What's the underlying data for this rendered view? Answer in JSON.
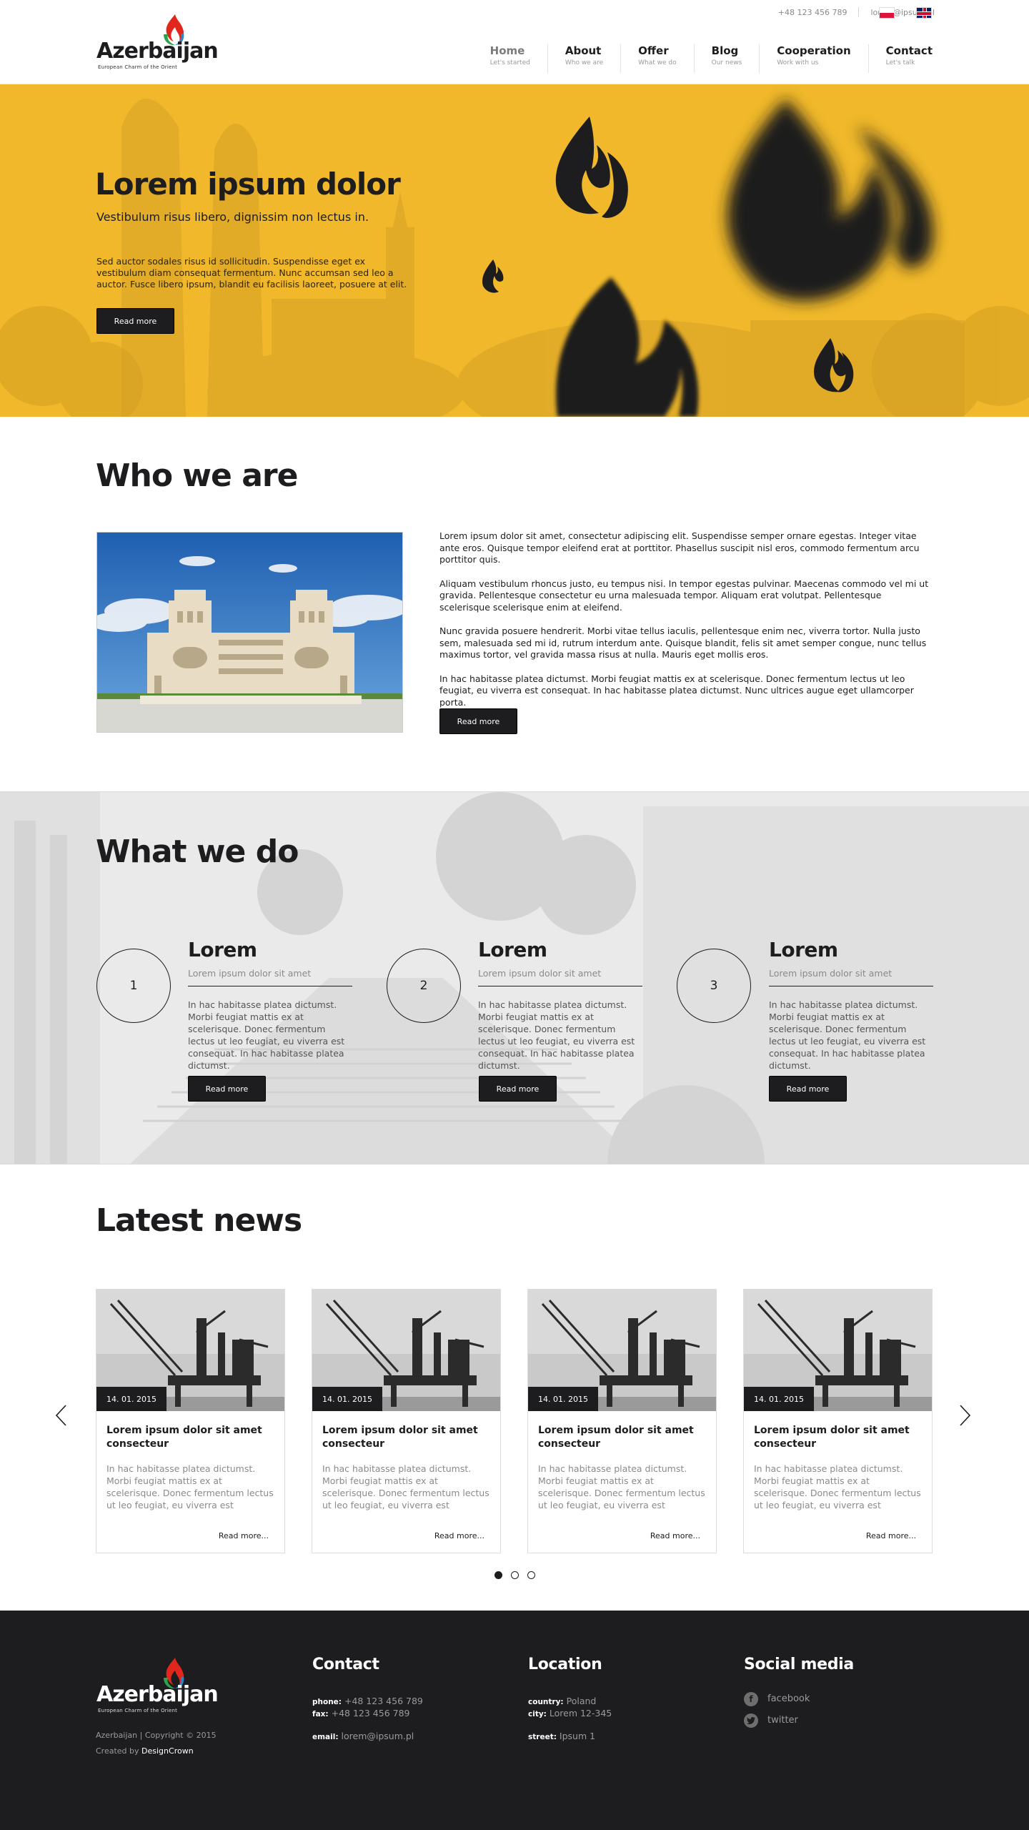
{
  "header": {
    "phone": "+48 123 456 789",
    "email": "lorem@ipsum.pl",
    "logo": {
      "name": "Azerbaijan",
      "tagline": "European Charm of the Orient"
    },
    "nav": [
      {
        "label": "Home",
        "sub": "Let's started"
      },
      {
        "label": "About",
        "sub": "Who we are"
      },
      {
        "label": "Offer",
        "sub": "What we do"
      },
      {
        "label": "Blog",
        "sub": "Our news"
      },
      {
        "label": "Cooperation",
        "sub": "Work with us"
      },
      {
        "label": "Contact",
        "sub": "Let's talk"
      }
    ],
    "languages": [
      "flag-pl-icon",
      "flag-uk-icon"
    ]
  },
  "hero": {
    "title": "Lorem ipsum dolor",
    "subtitle": "Vestibulum risus libero, dignissim non lectus in.",
    "body": "Sed auctor sodales risus id sollicitudin. Suspendisse eget ex vestibulum diam consequat fermentum. Nunc accumsan sed leo a auctor. Fusce libero ipsum, blandit eu facilisis laoreet, posuere at elit.",
    "button": "Read more",
    "color": "#f0b82a"
  },
  "who": {
    "title": "Who we are",
    "paragraphs": [
      "Lorem ipsum dolor sit amet, consectetur adipiscing elit. Suspendisse semper ornare egestas. Integer vitae ante eros. Quisque tempor eleifend erat at porttitor. Phasellus suscipit nisl eros, commodo fermentum arcu porttitor quis.",
      "Aliquam vestibulum rhoncus justo, eu tempus nisi. In tempor egestas pulvinar. Maecenas commodo vel mi ut gravida. Pellentesque consectetur eu urna malesuada tempor. Aliquam erat volutpat. Pellentesque scelerisque scelerisque enim at eleifend.",
      "Nunc gravida posuere hendrerit. Morbi vitae tellus iaculis, pellentesque enim nec, viverra tortor. Nulla justo sem, malesuada sed mi id, rutrum interdum ante. Quisque blandit, felis sit amet semper congue, nunc tellus maximus tortor, vel gravida massa risus at nulla. Mauris eget mollis eros.",
      "In hac habitasse platea dictumst. Morbi feugiat mattis ex at scelerisque. Donec fermentum lectus ut leo feugiat, eu viverra est consequat. In hac habitasse platea dictumst. Nunc ultrices augue eget ullamcorper porta."
    ],
    "button": "Read more"
  },
  "what": {
    "title": "What we do",
    "items": [
      {
        "number": "1",
        "title": "Lorem",
        "sub": "Lorem ipsum dolor sit amet",
        "body": "In hac habitasse platea dictumst. Morbi feugiat mattis ex at scelerisque. Donec fermentum lectus ut leo feugiat, eu viverra est consequat. In hac habitasse platea dictumst.",
        "button": "Read more"
      },
      {
        "number": "2",
        "title": "Lorem",
        "sub": "Lorem ipsum dolor sit amet",
        "body": "In hac habitasse platea dictumst. Morbi feugiat mattis ex at scelerisque. Donec fermentum lectus ut leo feugiat, eu viverra est consequat. In hac habitasse platea dictumst.",
        "button": "Read more"
      },
      {
        "number": "3",
        "title": "Lorem",
        "sub": "Lorem ipsum dolor sit amet",
        "body": "In hac habitasse platea dictumst. Morbi feugiat mattis ex at scelerisque. Donec fermentum lectus ut leo feugiat, eu viverra est consequat. In hac habitasse platea dictumst.",
        "button": "Read more"
      }
    ]
  },
  "news": {
    "title": "Latest news",
    "cards": [
      {
        "date": "14. 01. 2015",
        "title": "Lorem ipsum dolor sit amet consecteur",
        "body": "In hac habitasse platea dictumst. Morbi feugiat mattis ex at scelerisque. Donec fermentum lectus ut leo feugiat, eu viverra est consequat. In hac habitasse",
        "more": "Read more..."
      },
      {
        "date": "14. 01. 2015",
        "title": "Lorem ipsum dolor sit amet consecteur",
        "body": "In hac habitasse platea dictumst. Morbi feugiat mattis ex at scelerisque. Donec fermentum lectus ut leo feugiat, eu viverra est consequat. In hac habitasse",
        "more": "Read more..."
      },
      {
        "date": "14. 01. 2015",
        "title": "Lorem ipsum dolor sit amet consecteur",
        "body": "In hac habitasse platea dictumst. Morbi feugiat mattis ex at scelerisque. Donec fermentum lectus ut leo feugiat, eu viverra est consequat. In hac habitasse",
        "more": "Read more..."
      },
      {
        "date": "14. 01. 2015",
        "title": "Lorem ipsum dolor sit amet consecteur",
        "body": "In hac habitasse platea dictumst. Morbi feugiat mattis ex at scelerisque. Donec fermentum lectus ut leo feugiat, eu viverra est consequat. In hac habitasse",
        "more": "Read more..."
      }
    ],
    "active_page": 1,
    "pages": 3
  },
  "footer": {
    "logo": {
      "name": "Azerbaijan",
      "tagline": "European Charm of the Orient"
    },
    "copyright": "Azerbaijan  |  Copyright © 2015",
    "created_by_label": "Created by",
    "created_by": "DesignCrown",
    "contact": {
      "title": "Contact",
      "phone_label": "phone:",
      "phone": "+48 123 456 789",
      "fax_label": "fax:",
      "fax": "+48 123 456 789",
      "email_label": "email:",
      "email": "lorem@ipsum.pl"
    },
    "location": {
      "title": "Location",
      "country_label": "country:",
      "country": "Poland",
      "city_label": "city:",
      "city": "Lorem 12-345",
      "street_label": "street:",
      "street": "Ipsum 1"
    },
    "social": {
      "title": "Social media",
      "facebook": "facebook",
      "twitter": "twitter"
    }
  }
}
